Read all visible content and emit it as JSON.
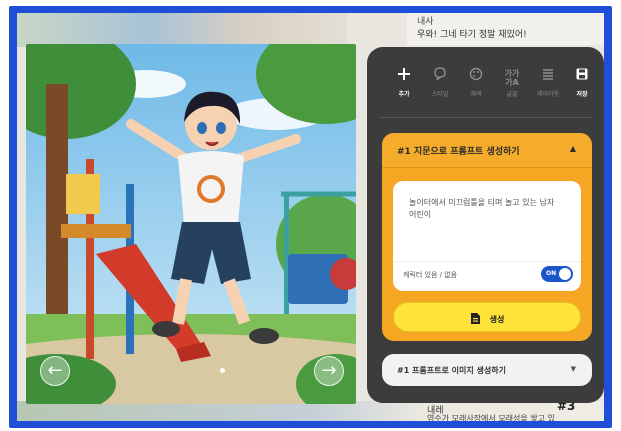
{
  "background": {
    "top_right_line1": "내사",
    "top_right_line2": "우와! 그네 타기 정말 재밌어!",
    "bottom_line1": "내레",
    "bottom_number": "#3",
    "bottom_line2": "영수가 모래사장에서 모래성을 쌓고 있"
  },
  "scene": {
    "prev_label": "←",
    "next_label": "→"
  },
  "toolbar": {
    "items": [
      {
        "icon": "plus-icon",
        "label": "추가",
        "active": true
      },
      {
        "icon": "speech-bubble-icon",
        "label": "스타일",
        "active": false
      },
      {
        "icon": "palette-icon",
        "label": "채색",
        "active": false
      },
      {
        "icon": "text-size-icon",
        "label": "글꼴",
        "active": false
      },
      {
        "icon": "list-icon",
        "label": "레이아웃",
        "active": false
      },
      {
        "icon": "save-icon",
        "label": "저장",
        "active": true
      }
    ]
  },
  "prompt_card": {
    "title": "#1 지문으로 프롬프트 생성하기",
    "caret": "▲",
    "input_text": "놀이터에서 미끄럼틀을 티며 놀고 있는 남자 어린이",
    "toggle_label": "캐릭터 있음 / 없음",
    "toggle_state": "ON",
    "generate_label": "생성"
  },
  "image_card": {
    "title": "#1 프롬프트로 이미지 생성하기",
    "caret": "▼"
  },
  "colors": {
    "frame": "#1f4fd6",
    "panel": "#3c3c3c",
    "accent_orange": "#f5a623",
    "accent_yellow": "#ffe23a",
    "toggle_blue": "#1a56c9"
  }
}
